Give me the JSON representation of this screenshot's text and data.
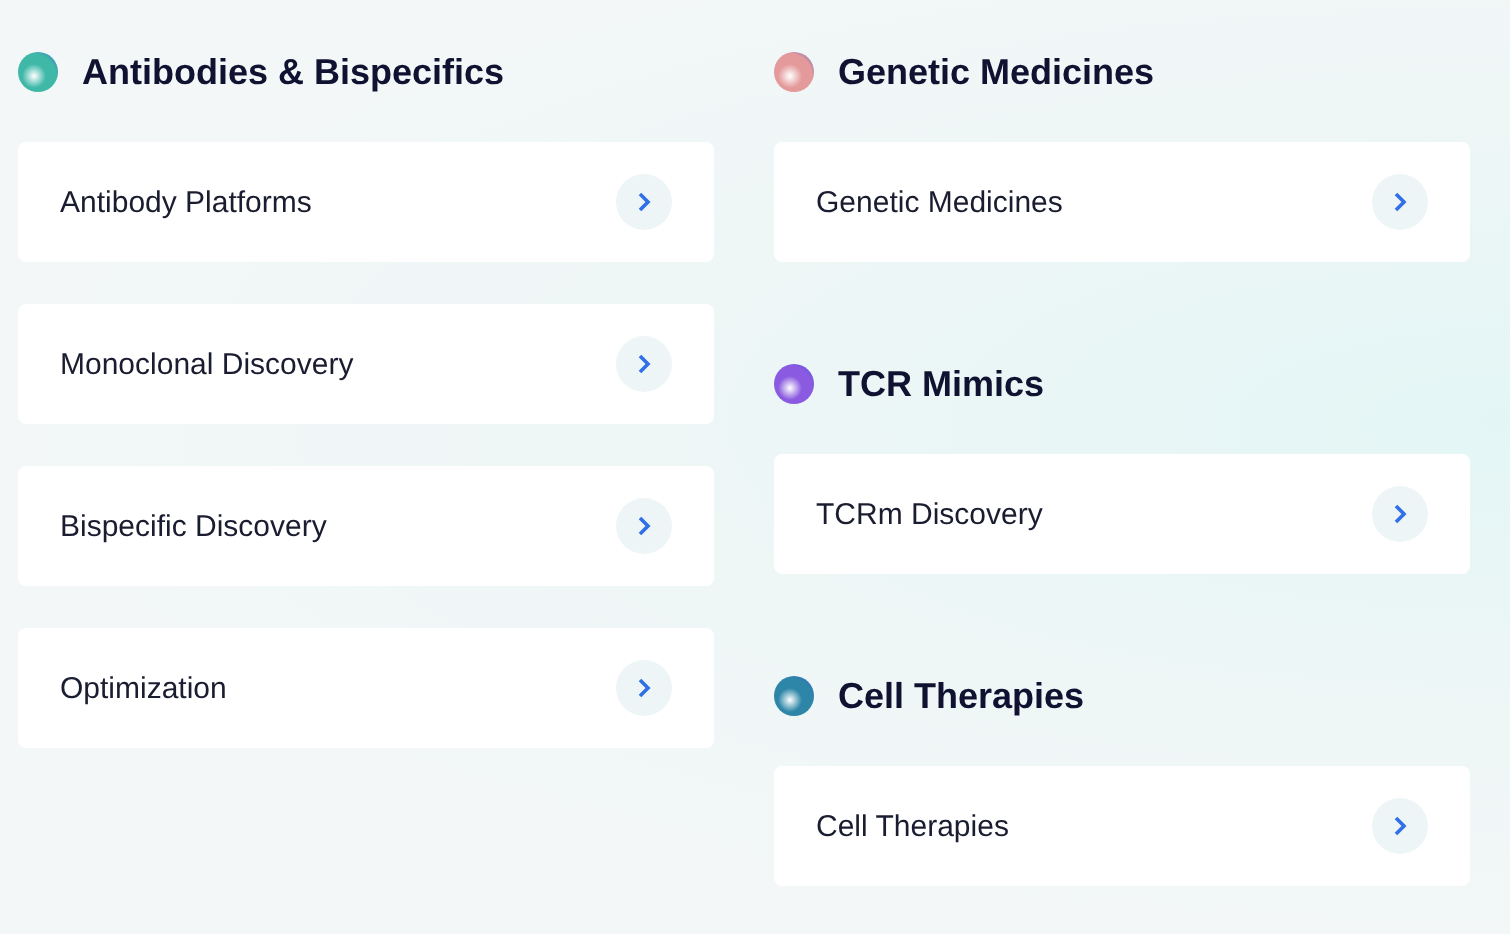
{
  "columns": [
    {
      "sections": [
        {
          "title": "Antibodies & Bispecifics",
          "color": "#3fb8a8",
          "items": [
            {
              "label": "Antibody Platforms"
            },
            {
              "label": "Monoclonal Discovery"
            },
            {
              "label": "Bispecific Discovery"
            },
            {
              "label": "Optimization"
            }
          ]
        }
      ]
    },
    {
      "sections": [
        {
          "title": "Genetic Medicines",
          "color": "#e49a9a",
          "items": [
            {
              "label": "Genetic Medicines"
            }
          ]
        },
        {
          "title": "TCR Mimics",
          "color": "#8a5ae0",
          "items": [
            {
              "label": "TCRm Discovery"
            }
          ]
        },
        {
          "title": "Cell Therapies",
          "color": "#2d86a8",
          "items": [
            {
              "label": "Cell Therapies"
            }
          ]
        }
      ]
    }
  ]
}
